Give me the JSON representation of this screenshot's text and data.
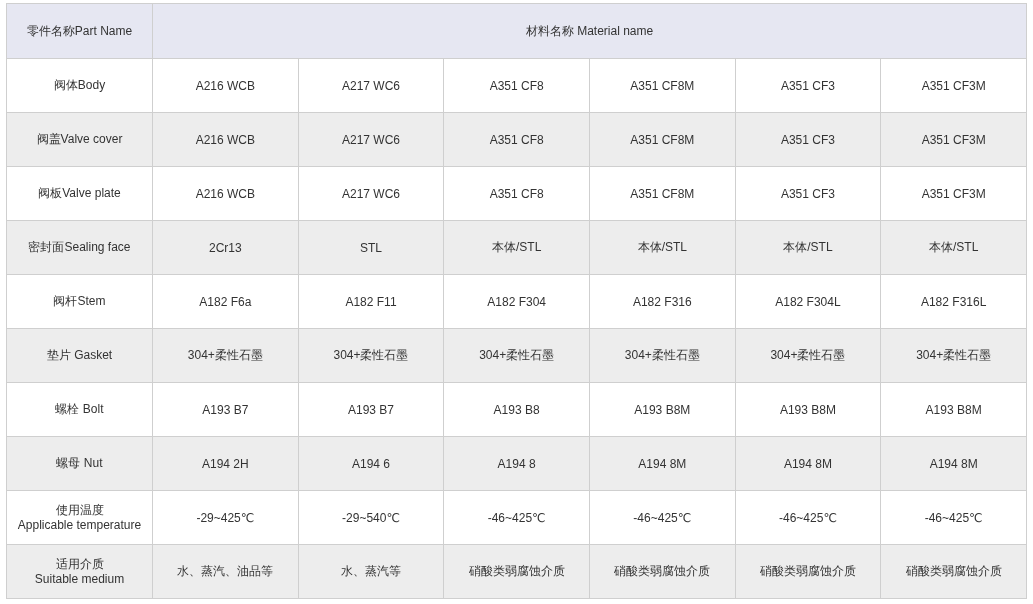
{
  "table": {
    "header": {
      "part_name": "零件名称Part Name",
      "material_name": "材料名称 Material name"
    },
    "rows": [
      {
        "part": "阀体Body",
        "materials": [
          "A216 WCB",
          "A217 WC6",
          "A351 CF8",
          "A351 CF8M",
          "A351 CF3",
          "A351 CF3M"
        ]
      },
      {
        "part": "阀盖Valve cover",
        "materials": [
          "A216 WCB",
          "A217 WC6",
          "A351 CF8",
          "A351 CF8M",
          "A351 CF3",
          "A351 CF3M"
        ]
      },
      {
        "part": "阀板Valve plate",
        "materials": [
          "A216 WCB",
          "A217 WC6",
          "A351 CF8",
          "A351 CF8M",
          "A351 CF3",
          "A351 CF3M"
        ]
      },
      {
        "part": "密封面Sealing face",
        "materials": [
          "2Cr13",
          "STL",
          "本体/STL",
          "本体/STL",
          "本体/STL",
          "本体/STL"
        ]
      },
      {
        "part": "阀杆Stem",
        "materials": [
          "A182 F6a",
          "A182 F11",
          "A182 F304",
          "A182 F316",
          "A182 F304L",
          "A182 F316L"
        ]
      },
      {
        "part": "垫片 Gasket",
        "materials": [
          "304+柔性石墨",
          "304+柔性石墨",
          "304+柔性石墨",
          "304+柔性石墨",
          "304+柔性石墨",
          "304+柔性石墨"
        ]
      },
      {
        "part": "螺栓 Bolt",
        "materials": [
          "A193 B7",
          "A193 B7",
          "A193 B8",
          "A193 B8M",
          "A193 B8M",
          "A193 B8M"
        ]
      },
      {
        "part": "螺母 Nut",
        "materials": [
          "A194 2H",
          "A194 6",
          "A194 8",
          "A194 8M",
          "A194 8M",
          "A194 8M"
        ]
      },
      {
        "part": "使用温度\nApplicable temperature",
        "materials": [
          "-29~425℃",
          "-29~540℃",
          "-46~425℃",
          "-46~425℃",
          "-46~425℃",
          "-46~425℃"
        ]
      },
      {
        "part": "适用介质\nSuitable medium",
        "materials": [
          "水、蒸汽、油品等",
          "水、蒸汽等",
          "硝酸类弱腐蚀介质",
          "硝酸类弱腐蚀介质",
          "硝酸类弱腐蚀介质",
          "硝酸类弱腐蚀介质"
        ]
      }
    ]
  }
}
